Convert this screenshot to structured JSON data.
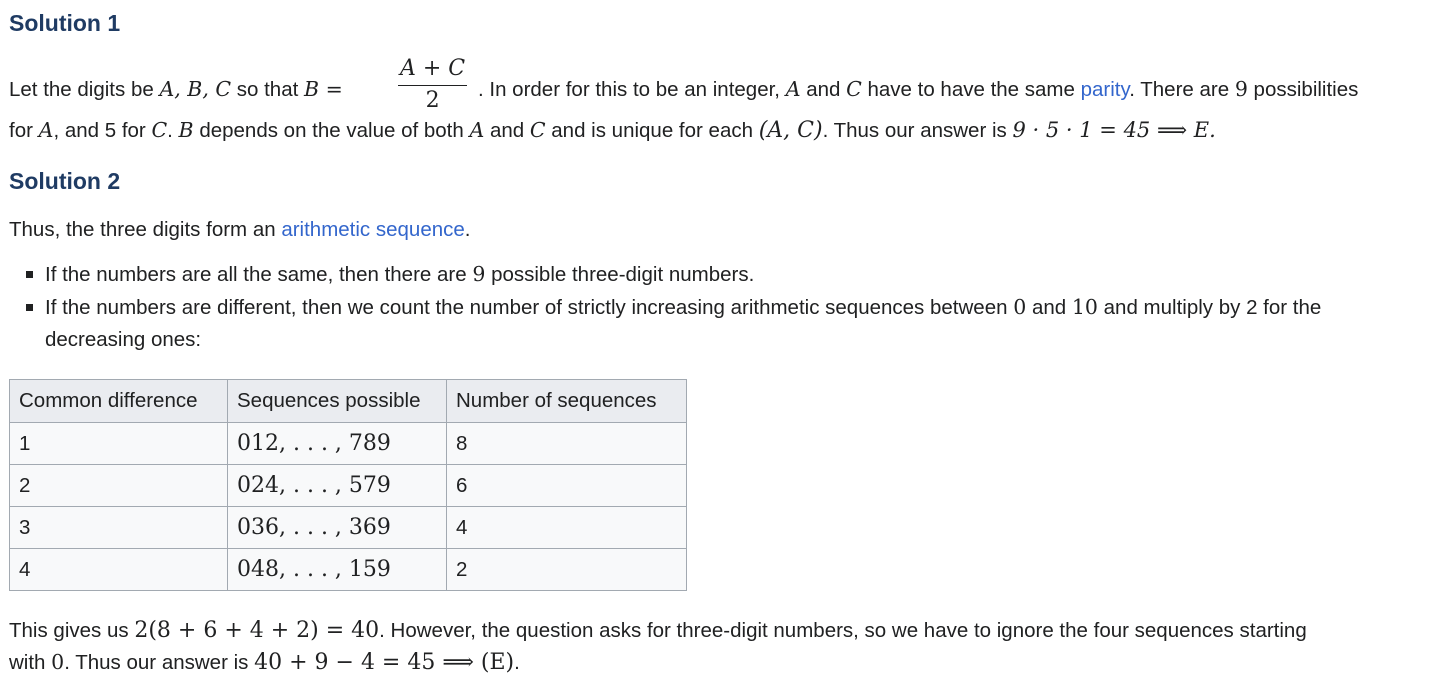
{
  "solution1": {
    "heading": "Solution 1",
    "line1": {
      "t1": "Let the digits be ",
      "m1": "A, B, C",
      "t2": " so that ",
      "m2": "B =",
      "frac_num": "A + C",
      "frac_den": "2",
      "t3": ". In order for this to be an integer, ",
      "m3": "A",
      "t4": " and ",
      "m4": "C",
      "t5": " have to have the same ",
      "link_parity": "parity",
      "t6": ". There are ",
      "m5": "9",
      "t7": " possibilities"
    },
    "line2": {
      "t1": "for ",
      "m1": "A",
      "t2": ", and 5 for ",
      "m2": "C",
      "t3": ". ",
      "m3": "B",
      "t4": " depends on the value of both ",
      "m4": "A",
      "t5": " and ",
      "m5": "C",
      "t6": " and is unique for each ",
      "m6": "(A, C)",
      "t7": ". Thus our answer is ",
      "m7": "9 · 5 · 1 = 45  ⟹  E."
    }
  },
  "solution2": {
    "heading": "Solution 2",
    "intro": {
      "t1": "Thus, the three digits form an ",
      "link": "arithmetic sequence",
      "t2": "."
    },
    "bullet1": {
      "t1": "If the numbers are all the same, then there are ",
      "m1": "9",
      "t2": " possible three-digit numbers."
    },
    "bullet2": {
      "t1": "If the numbers are different, then we count the number of strictly increasing arithmetic sequences between ",
      "m1": "0",
      "t2": " and ",
      "m2": "10",
      "t3": " and multiply by 2 for the",
      "line2": "decreasing ones:"
    },
    "table": {
      "headers": [
        "Common difference",
        "Sequences possible",
        "Number of sequences"
      ],
      "rows": [
        [
          "1",
          "012, . . . , 789",
          "8"
        ],
        [
          "2",
          "024, . . . , 579",
          "6"
        ],
        [
          "3",
          "036, . . . , 369",
          "4"
        ],
        [
          "4",
          "048, . . . , 159",
          "2"
        ]
      ]
    },
    "conclusion1": {
      "t1": "This gives us ",
      "m1": "2(8 + 6 + 4 + 2) = 40",
      "t2": ". However, the question asks for three-digit numbers, so we have to ignore the four sequences starting"
    },
    "conclusion2": {
      "t1": "with ",
      "m1": "0",
      "t2": ". Thus our answer is ",
      "m2": "40 + 9 − 4 = 45 ⟹ (E)",
      "t3": "."
    }
  }
}
